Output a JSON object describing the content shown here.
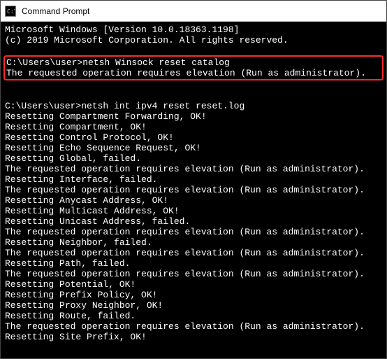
{
  "window": {
    "title": "Command Prompt"
  },
  "terminal": {
    "lines": [
      "Microsoft Windows [Version 10.0.18363.1198]",
      "(c) 2019 Microsoft Corporation. All rights reserved.",
      "",
      "C:\\Users\\user>netsh Winsock reset catalog",
      "The requested operation requires elevation (Run as administrator).",
      "",
      "",
      "C:\\Users\\user>netsh int ipv4 reset reset.log",
      "Resetting Compartment Forwarding, OK!",
      "Resetting Compartment, OK!",
      "Resetting Control Protocol, OK!",
      "Resetting Echo Sequence Request, OK!",
      "Resetting Global, failed.",
      "The requested operation requires elevation (Run as administrator).",
      "Resetting Interface, failed.",
      "The requested operation requires elevation (Run as administrator).",
      "Resetting Anycast Address, OK!",
      "Resetting Multicast Address, OK!",
      "Resetting Unicast Address, failed.",
      "The requested operation requires elevation (Run as administrator).",
      "Resetting Neighbor, failed.",
      "The requested operation requires elevation (Run as administrator).",
      "Resetting Path, failed.",
      "The requested operation requires elevation (Run as administrator).",
      "Resetting Potential, OK!",
      "Resetting Prefix Policy, OK!",
      "Resetting Proxy Neighbor, OK!",
      "Resetting Route, failed.",
      "The requested operation requires elevation (Run as administrator).",
      "Resetting Site Prefix, OK!"
    ],
    "highlight_start": 3,
    "highlight_end": 4
  }
}
